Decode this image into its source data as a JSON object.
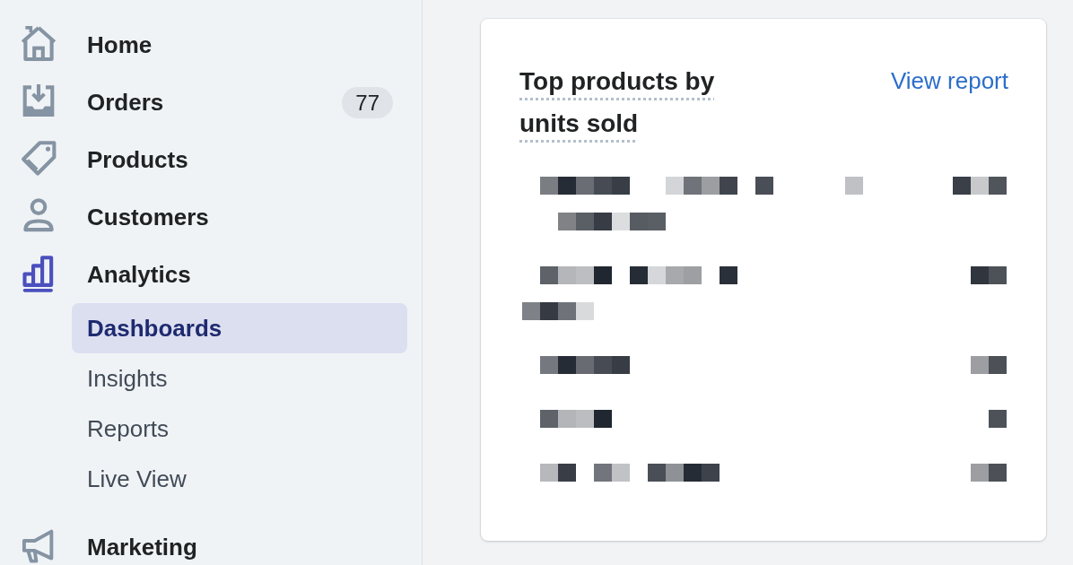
{
  "sidebar": {
    "items": [
      {
        "label": "Home",
        "selected": false
      },
      {
        "label": "Orders",
        "badge": "77",
        "selected": false
      },
      {
        "label": "Products",
        "selected": false
      },
      {
        "label": "Customers",
        "selected": false
      },
      {
        "label": "Analytics",
        "selected": true,
        "children": [
          {
            "label": "Dashboards",
            "selected": true
          },
          {
            "label": "Insights",
            "selected": false
          },
          {
            "label": "Reports",
            "selected": false
          },
          {
            "label": "Live View",
            "selected": false
          }
        ]
      },
      {
        "label": "Marketing",
        "selected": false
      }
    ]
  },
  "card": {
    "title": "Top products by units sold",
    "link": "View report",
    "rows": [
      {
        "kind": "pixelated"
      },
      {
        "kind": "pixelated"
      },
      {
        "kind": "pixelated"
      },
      {
        "kind": "pixelated"
      },
      {
        "kind": "pixelated"
      }
    ]
  }
}
